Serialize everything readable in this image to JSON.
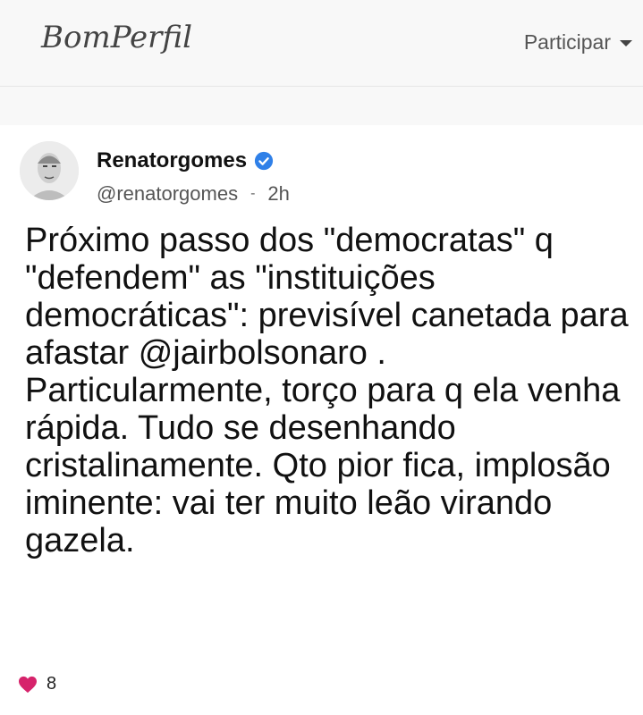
{
  "header": {
    "logo_text": "BomPerfil",
    "menu_label": "Participar"
  },
  "post": {
    "author_name": "Renatorgomes",
    "verified": true,
    "handle": "@renatorgomes",
    "separator": "-",
    "time": "2h",
    "text": "Próximo passo dos \"democratas\" q \"defendem\" as \"instituições democráticas\": previsível canetada para afastar @jairbolsonaro . Particularmente, torço para q ela venha rápida. Tudo se desenhando cristalinamente. Qto pior fica, implosão iminente: vai ter muito leão virando gazela.",
    "likes_count": "8"
  },
  "colors": {
    "verified_badge": "#2f80e8",
    "heart": "#d6236b"
  }
}
